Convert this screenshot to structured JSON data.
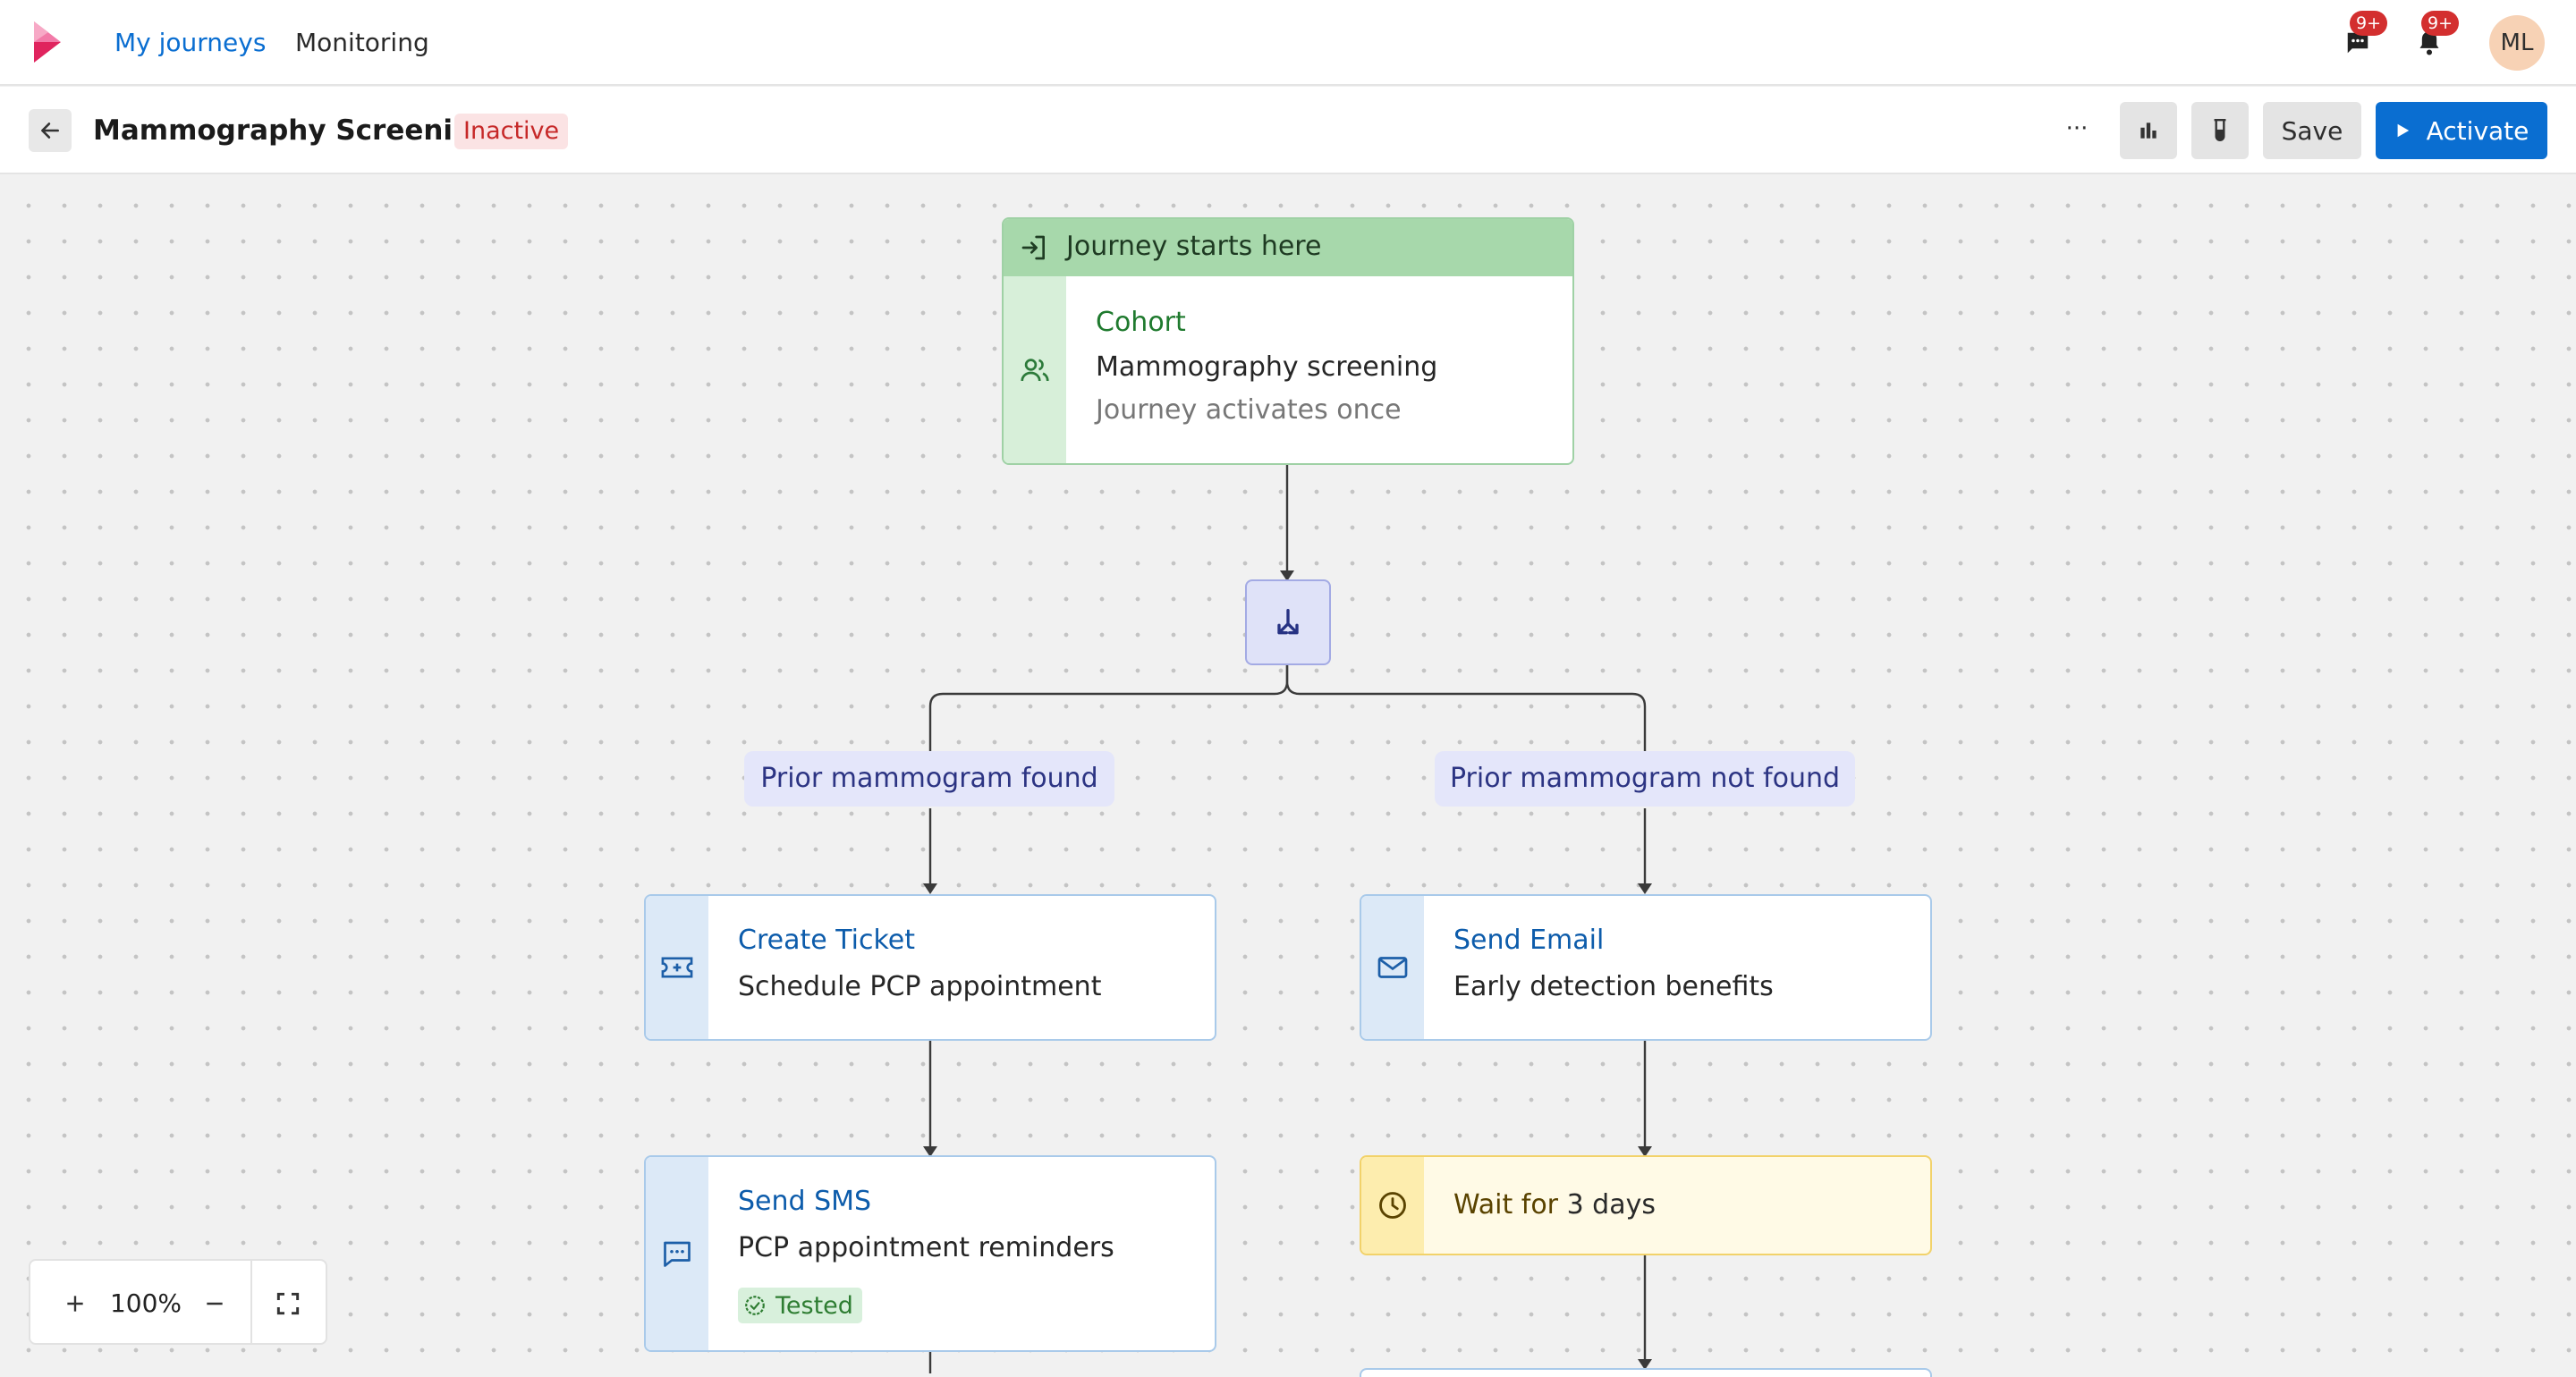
{
  "nav": {
    "links": [
      "My journeys",
      "Monitoring"
    ],
    "messages_badge": "9+",
    "notifications_badge": "9+",
    "avatar_initials": "ML"
  },
  "toolbar": {
    "title": "Mammography Screening",
    "status": "Inactive",
    "more": "···",
    "save": "Save",
    "activate": "Activate"
  },
  "flow": {
    "start": {
      "header": "Journey starts here",
      "type": "Cohort",
      "name": "Mammography screening",
      "note": "Journey activates once"
    },
    "branches": [
      "Prior mammogram found",
      "Prior mammogram not found"
    ],
    "left": [
      {
        "type": "Create Ticket",
        "text": "Schedule PCP appointment"
      },
      {
        "type": "Send SMS",
        "text": "PCP appointment reminders",
        "tag": "Tested"
      }
    ],
    "right": [
      {
        "type": "Send Email",
        "text": "Early detection benefits"
      },
      {
        "label": "Wait for",
        "value": "3 days"
      }
    ]
  },
  "zoom": {
    "level": "100%"
  },
  "colors": {
    "primary": "#0a6ed1",
    "link": "#0a6ed1",
    "start_green": "#a7d8ab",
    "cohort_title": "#1f7a2e",
    "action_title": "#0d5cab",
    "branch_text": "#2c3483",
    "wait_text": "#5a4300",
    "danger": "#c62828"
  }
}
